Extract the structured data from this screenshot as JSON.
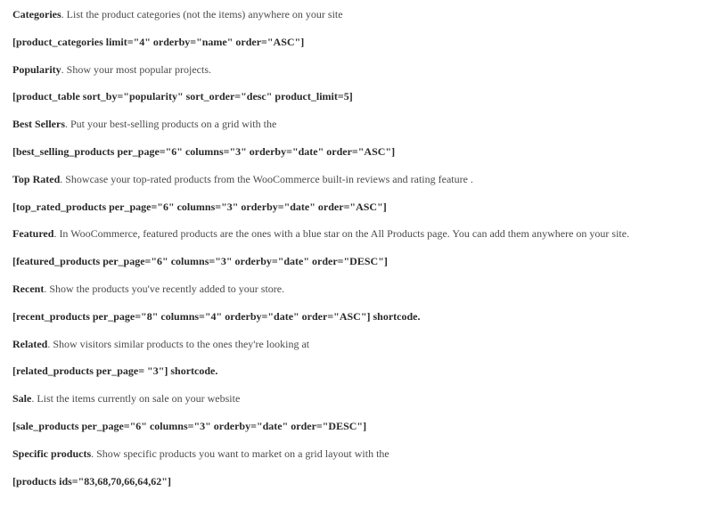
{
  "sections": [
    {
      "title": "Categories",
      "desc": ". List the product categories (not the items) anywhere on your site",
      "code": "[product_categories limit=\"4\" orderby=\"name\" order=\"ASC\"]",
      "code_suffix": ""
    },
    {
      "title": "Popularity",
      "desc": ". Show your most popular projects.",
      "code": "[product_table sort_by=\"popularity\" sort_order=\"desc\" product_limit=5]",
      "code_suffix": ""
    },
    {
      "title": "Best Sellers",
      "desc": ". Put your best-selling products on a grid with the",
      "code": "[best_selling_products per_page=\"6\" columns=\"3\" orderby=\"date\" order=\"ASC\"]",
      "code_suffix": ""
    },
    {
      "title": "Top Rated",
      "desc": ". Showcase your top-rated products from the WooCommerce built-in reviews and rating feature .",
      "code": "[top_rated_products per_page=\"6\" columns=\"3\" orderby=\"date\" order=\"ASC\"]",
      "code_suffix": ""
    },
    {
      "title": "Featured",
      "desc": ". In WooCommerce, featured products are the ones with a blue star on the All Products page. You can add them anywhere on your site.",
      "code": "[featured_products per_page=\"6\" columns=\"3\" orderby=\"date\" order=\"DESC\"]",
      "code_suffix": ""
    },
    {
      "title": "Recent",
      "desc": ". Show the products you've recently added to your store.",
      "code": "[recent_products per_page=\"8\" columns=\"4\" orderby=\"date\" order=\"ASC\"] shortcode.",
      "code_suffix": ""
    },
    {
      "title": "Related",
      "desc": ". Show visitors similar products to the ones they're looking at",
      "code": "[related_products per_page= \"3\"] shortcode.",
      "code_suffix": ""
    },
    {
      "title": "Sale",
      "desc": ". List the items currently on sale on your website",
      "code": "[sale_products per_page=\"6\" columns=\"3\" orderby=\"date\" order=\"DESC\"]",
      "code_suffix": ""
    },
    {
      "title": "Specific products",
      "desc": ". Show specific products you want to market on a grid layout with the",
      "code": "[products ids=\"83,68,70,66,64,62\"]",
      "code_suffix": ""
    }
  ]
}
